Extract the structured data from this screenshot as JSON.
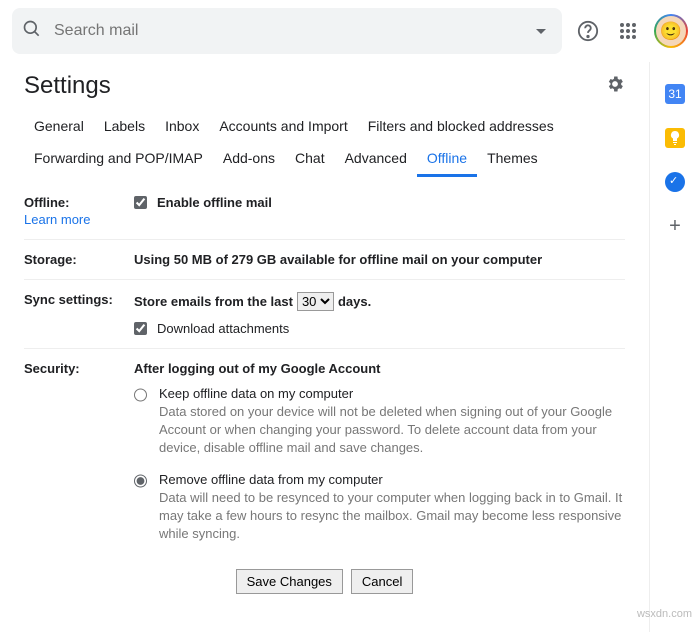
{
  "search": {
    "placeholder": "Search mail"
  },
  "title": "Settings",
  "tabs": [
    "General",
    "Labels",
    "Inbox",
    "Accounts and Import",
    "Filters and blocked addresses",
    "Forwarding and POP/IMAP",
    "Add-ons",
    "Chat",
    "Advanced",
    "Offline",
    "Themes"
  ],
  "activeTab": "Offline",
  "offline": {
    "label": "Offline:",
    "learn": "Learn more",
    "enable": "Enable offline mail"
  },
  "storage": {
    "label": "Storage:",
    "text": "Using 50 MB of 279 GB available for offline mail on your computer"
  },
  "sync": {
    "label": "Sync settings:",
    "pre": "Store emails from the last",
    "value": "30",
    "post": "days.",
    "download": "Download attachments"
  },
  "security": {
    "label": "Security:",
    "head": "After logging out of my Google Account",
    "opt1": {
      "title": "Keep offline data on my computer",
      "desc": "Data stored on your device will not be deleted when signing out of your Google Account or when changing your password. To delete account data from your device, disable offline mail and save changes."
    },
    "opt2": {
      "title": "Remove offline data from my computer",
      "desc": "Data will need to be resynced to your computer when logging back in to Gmail. It may take a few hours to resync the mailbox. Gmail may become less responsive while syncing."
    }
  },
  "buttons": {
    "save": "Save Changes",
    "cancel": "Cancel"
  },
  "watermark": "wsxdn.com"
}
